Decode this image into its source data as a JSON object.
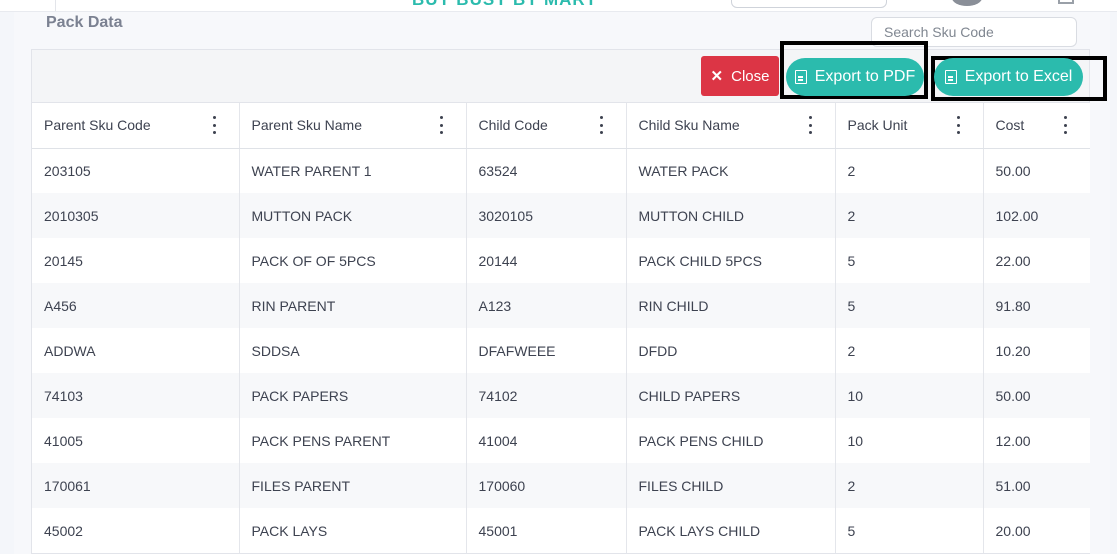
{
  "header": {
    "brand": "BUY BUSY BY MART"
  },
  "page": {
    "title": "Pack Data"
  },
  "search": {
    "placeholder": "Search Sku Code"
  },
  "toolbar": {
    "close_label": "Close",
    "export_pdf_label": "Export to PDF",
    "export_excel_label": "Export to Excel"
  },
  "table": {
    "headers": [
      "Parent Sku Code",
      "Parent Sku Name",
      "Child Code",
      "Child Sku Name",
      "Pack Unit",
      "Cost"
    ],
    "rows": [
      [
        "203105",
        "WATER PARENT 1",
        "63524",
        "WATER PACK",
        "2",
        "50.00"
      ],
      [
        "2010305",
        "MUTTON PACK",
        "3020105",
        "MUTTON CHILD",
        "2",
        "102.00"
      ],
      [
        "20145",
        "PACK OF OF 5PCS",
        "20144",
        "PACK CHILD 5PCS",
        "5",
        "22.00"
      ],
      [
        "A456",
        "RIN PARENT",
        "A123",
        "RIN CHILD",
        "5",
        "91.80"
      ],
      [
        "ADDWA",
        "SDDSA",
        "DFAFWEEE",
        "DFDD",
        "2",
        "10.20"
      ],
      [
        "74103",
        "PACK PAPERS",
        "74102",
        "CHILD PAPERS",
        "10",
        "50.00"
      ],
      [
        "41005",
        "PACK PENS PARENT",
        "41004",
        "PACK PENS CHILD",
        "10",
        "12.00"
      ],
      [
        "170061",
        "FILES PARENT",
        "170060",
        "FILES CHILD",
        "2",
        "51.00"
      ],
      [
        "45002",
        "PACK LAYS",
        "45001",
        "PACK LAYS CHILD",
        "5",
        "20.00"
      ]
    ]
  },
  "colors": {
    "accent": "#2bbbad",
    "danger": "#dc3545",
    "text": "#3d4250",
    "title": "#7b8191"
  },
  "icons": {
    "close": "close-icon",
    "pdf": "pdf-file-icon",
    "excel": "excel-file-icon",
    "column_menu": "kebab-menu-icon"
  }
}
